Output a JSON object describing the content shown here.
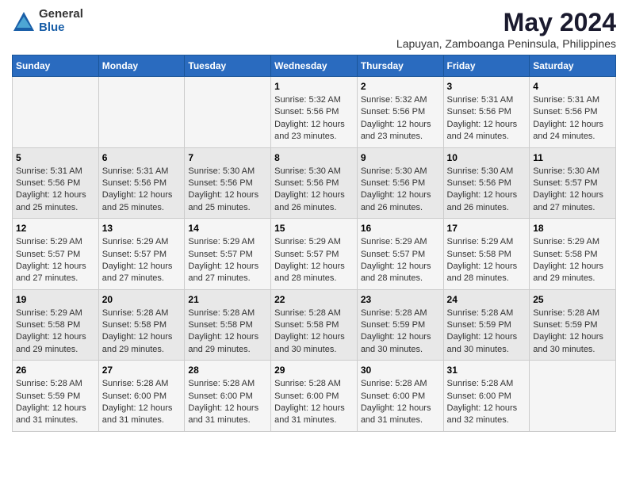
{
  "logo": {
    "general": "General",
    "blue": "Blue"
  },
  "title": "May 2024",
  "subtitle": "Lapuyan, Zamboanga Peninsula, Philippines",
  "headers": [
    "Sunday",
    "Monday",
    "Tuesday",
    "Wednesday",
    "Thursday",
    "Friday",
    "Saturday"
  ],
  "weeks": [
    [
      {
        "day": "",
        "info": ""
      },
      {
        "day": "",
        "info": ""
      },
      {
        "day": "",
        "info": ""
      },
      {
        "day": "1",
        "info": "Sunrise: 5:32 AM\nSunset: 5:56 PM\nDaylight: 12 hours\nand 23 minutes."
      },
      {
        "day": "2",
        "info": "Sunrise: 5:32 AM\nSunset: 5:56 PM\nDaylight: 12 hours\nand 23 minutes."
      },
      {
        "day": "3",
        "info": "Sunrise: 5:31 AM\nSunset: 5:56 PM\nDaylight: 12 hours\nand 24 minutes."
      },
      {
        "day": "4",
        "info": "Sunrise: 5:31 AM\nSunset: 5:56 PM\nDaylight: 12 hours\nand 24 minutes."
      }
    ],
    [
      {
        "day": "5",
        "info": "Sunrise: 5:31 AM\nSunset: 5:56 PM\nDaylight: 12 hours\nand 25 minutes."
      },
      {
        "day": "6",
        "info": "Sunrise: 5:31 AM\nSunset: 5:56 PM\nDaylight: 12 hours\nand 25 minutes."
      },
      {
        "day": "7",
        "info": "Sunrise: 5:30 AM\nSunset: 5:56 PM\nDaylight: 12 hours\nand 25 minutes."
      },
      {
        "day": "8",
        "info": "Sunrise: 5:30 AM\nSunset: 5:56 PM\nDaylight: 12 hours\nand 26 minutes."
      },
      {
        "day": "9",
        "info": "Sunrise: 5:30 AM\nSunset: 5:56 PM\nDaylight: 12 hours\nand 26 minutes."
      },
      {
        "day": "10",
        "info": "Sunrise: 5:30 AM\nSunset: 5:56 PM\nDaylight: 12 hours\nand 26 minutes."
      },
      {
        "day": "11",
        "info": "Sunrise: 5:30 AM\nSunset: 5:57 PM\nDaylight: 12 hours\nand 27 minutes."
      }
    ],
    [
      {
        "day": "12",
        "info": "Sunrise: 5:29 AM\nSunset: 5:57 PM\nDaylight: 12 hours\nand 27 minutes."
      },
      {
        "day": "13",
        "info": "Sunrise: 5:29 AM\nSunset: 5:57 PM\nDaylight: 12 hours\nand 27 minutes."
      },
      {
        "day": "14",
        "info": "Sunrise: 5:29 AM\nSunset: 5:57 PM\nDaylight: 12 hours\nand 27 minutes."
      },
      {
        "day": "15",
        "info": "Sunrise: 5:29 AM\nSunset: 5:57 PM\nDaylight: 12 hours\nand 28 minutes."
      },
      {
        "day": "16",
        "info": "Sunrise: 5:29 AM\nSunset: 5:57 PM\nDaylight: 12 hours\nand 28 minutes."
      },
      {
        "day": "17",
        "info": "Sunrise: 5:29 AM\nSunset: 5:58 PM\nDaylight: 12 hours\nand 28 minutes."
      },
      {
        "day": "18",
        "info": "Sunrise: 5:29 AM\nSunset: 5:58 PM\nDaylight: 12 hours\nand 29 minutes."
      }
    ],
    [
      {
        "day": "19",
        "info": "Sunrise: 5:29 AM\nSunset: 5:58 PM\nDaylight: 12 hours\nand 29 minutes."
      },
      {
        "day": "20",
        "info": "Sunrise: 5:28 AM\nSunset: 5:58 PM\nDaylight: 12 hours\nand 29 minutes."
      },
      {
        "day": "21",
        "info": "Sunrise: 5:28 AM\nSunset: 5:58 PM\nDaylight: 12 hours\nand 29 minutes."
      },
      {
        "day": "22",
        "info": "Sunrise: 5:28 AM\nSunset: 5:58 PM\nDaylight: 12 hours\nand 30 minutes."
      },
      {
        "day": "23",
        "info": "Sunrise: 5:28 AM\nSunset: 5:59 PM\nDaylight: 12 hours\nand 30 minutes."
      },
      {
        "day": "24",
        "info": "Sunrise: 5:28 AM\nSunset: 5:59 PM\nDaylight: 12 hours\nand 30 minutes."
      },
      {
        "day": "25",
        "info": "Sunrise: 5:28 AM\nSunset: 5:59 PM\nDaylight: 12 hours\nand 30 minutes."
      }
    ],
    [
      {
        "day": "26",
        "info": "Sunrise: 5:28 AM\nSunset: 5:59 PM\nDaylight: 12 hours\nand 31 minutes."
      },
      {
        "day": "27",
        "info": "Sunrise: 5:28 AM\nSunset: 6:00 PM\nDaylight: 12 hours\nand 31 minutes."
      },
      {
        "day": "28",
        "info": "Sunrise: 5:28 AM\nSunset: 6:00 PM\nDaylight: 12 hours\nand 31 minutes."
      },
      {
        "day": "29",
        "info": "Sunrise: 5:28 AM\nSunset: 6:00 PM\nDaylight: 12 hours\nand 31 minutes."
      },
      {
        "day": "30",
        "info": "Sunrise: 5:28 AM\nSunset: 6:00 PM\nDaylight: 12 hours\nand 31 minutes."
      },
      {
        "day": "31",
        "info": "Sunrise: 5:28 AM\nSunset: 6:00 PM\nDaylight: 12 hours\nand 32 minutes."
      },
      {
        "day": "",
        "info": ""
      }
    ]
  ]
}
